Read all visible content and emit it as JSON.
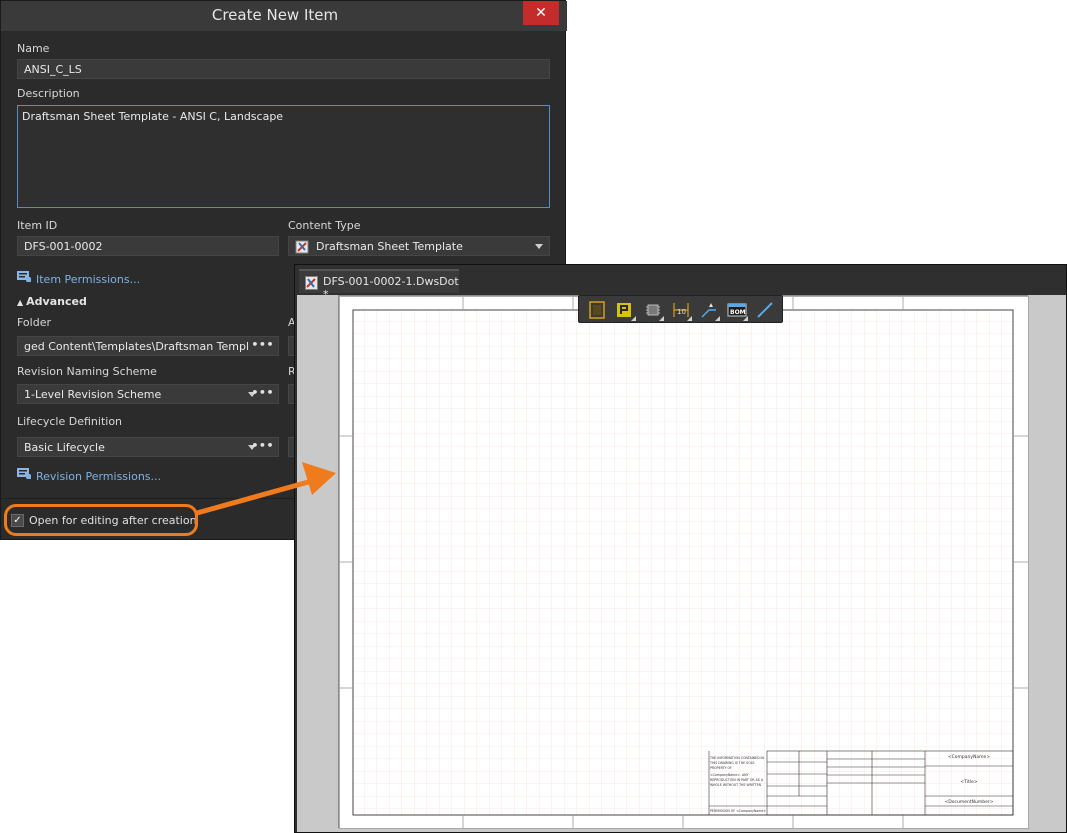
{
  "dialog": {
    "title": "Create New Item",
    "close_label": "✕",
    "name": {
      "label": "Name",
      "value": "ANSI_C_LS"
    },
    "description": {
      "label": "Description",
      "value": "Draftsman Sheet Template - ANSI C, Landscape"
    },
    "item_id": {
      "label": "Item ID",
      "value": "DFS-001-0002"
    },
    "content_type": {
      "label": "Content Type",
      "value": "Draftsman Sheet Template"
    },
    "item_permissions_link": "Item Permissions...",
    "advanced_label": "Advanced",
    "folder": {
      "label": "Folder",
      "value": "ged Content\\Templates\\Draftsman Templates"
    },
    "revision_naming": {
      "label": "Revision Naming Scheme",
      "value": "1-Level Revision Scheme"
    },
    "lifecycle": {
      "label": "Lifecycle Definition",
      "value": "Basic Lifecycle"
    },
    "revision_permissions_link": "Revision Permissions...",
    "partial_labels": [
      "A",
      "R"
    ],
    "open_after_creation": {
      "label": "Open for editing after creation",
      "checked": true
    },
    "more_button": "•••"
  },
  "editor": {
    "tab_label": "DFS-001-0002-1.DwsDot *",
    "toolbar_icons": [
      "board-view-icon",
      "place-part-icon",
      "place-chip-icon",
      "place-dimension-icon",
      "place-line-icon",
      "bom-icon",
      "draw-line-icon"
    ],
    "toolbar_bom_text": "BOM",
    "title_block": {
      "company_name": "<CompanyName>",
      "title": "<Title>",
      "document_number": "<DocumentNumber>",
      "notice_lines": [
        "THE INFORMATION CONTAINED IN",
        "THIS DRAWING IS THE SOLE",
        "PROPERTY OF",
        "<CompanyName>. ANY",
        "REPRODUCTION IN PART OR AS A",
        "WHOLE WITHOUT THE WRITTEN"
      ],
      "notice_footer": "PERMISSION OF <CompanyName>"
    }
  },
  "annotation": {
    "accent_color": "#ef7b1c"
  }
}
